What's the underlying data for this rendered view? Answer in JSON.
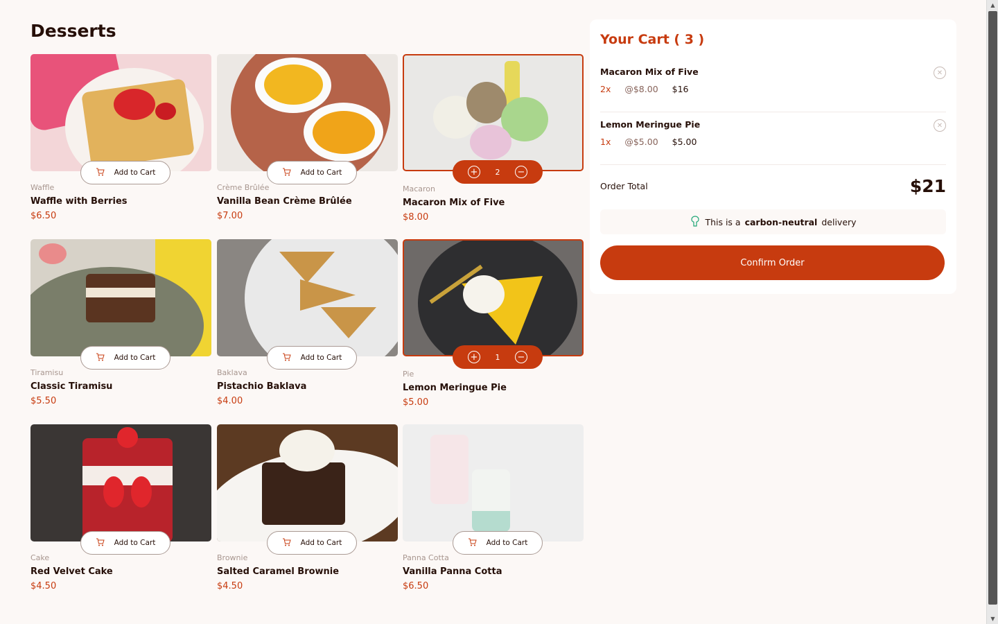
{
  "page_title": "Desserts",
  "add_to_cart_label": "Add to Cart",
  "products": [
    {
      "category": "Waffle",
      "name": "Waffle with Berries",
      "price": "$6.50",
      "selected": false
    },
    {
      "category": "Crème Brûlée",
      "name": "Vanilla Bean Crème Brûlée",
      "price": "$7.00",
      "selected": false
    },
    {
      "category": "Macaron",
      "name": "Macaron Mix of Five",
      "price": "$8.00",
      "selected": true,
      "quantity": "2"
    },
    {
      "category": "Tiramisu",
      "name": "Classic Tiramisu",
      "price": "$5.50",
      "selected": false
    },
    {
      "category": "Baklava",
      "name": "Pistachio Baklava",
      "price": "$4.00",
      "selected": false
    },
    {
      "category": "Pie",
      "name": "Lemon Meringue Pie",
      "price": "$5.00",
      "selected": true,
      "quantity": "1"
    },
    {
      "category": "Cake",
      "name": "Red Velvet Cake",
      "price": "$4.50",
      "selected": false
    },
    {
      "category": "Brownie",
      "name": "Salted Caramel Brownie",
      "price": "$4.50",
      "selected": false
    },
    {
      "category": "Panna Cotta",
      "name": "Vanilla Panna Cotta",
      "price": "$6.50",
      "selected": false
    }
  ],
  "cart": {
    "title": "Your Cart ( 3 )",
    "items": [
      {
        "name": "Macaron Mix of Five",
        "qty": "2x",
        "unit": "@$8.00",
        "total": "$16"
      },
      {
        "name": "Lemon Meringue Pie",
        "qty": "1x",
        "unit": "@$5.00",
        "total": "$5.00"
      }
    ],
    "order_total_label": "Order Total",
    "order_total_value": "$21",
    "carbon_prefix": "This is a",
    "carbon_bold": "carbon-neutral",
    "carbon_suffix": "delivery",
    "confirm_label": "Confirm Order"
  },
  "colors": {
    "accent": "#c73b0f",
    "background": "#fcf8f6",
    "text": "#260f08"
  },
  "icons": {
    "add_to_cart": "cart-plus-icon",
    "increment": "plus-circle-icon",
    "decrement": "minus-circle-icon",
    "remove": "close-circle-icon",
    "carbon": "tree-icon"
  }
}
